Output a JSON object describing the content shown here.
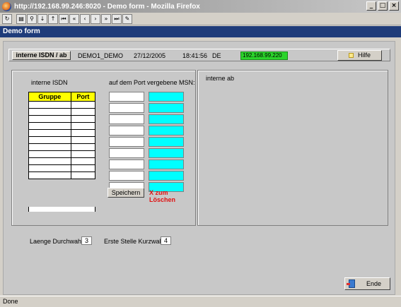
{
  "window": {
    "title": "http://192.168.99.246:8020 - Demo form - Mozilla Firefox"
  },
  "toolbar": {
    "icons": [
      "refresh-icon",
      "print-icon",
      "find-icon",
      "find-next-icon",
      "find-prev-icon",
      "first-record-icon",
      "previous-page-icon",
      "previous-icon",
      "next-icon",
      "next-page-icon",
      "last-record-icon",
      "edit-icon"
    ]
  },
  "page": {
    "title": "Demo form"
  },
  "infobar": {
    "module_label": "interne ISDN / ab",
    "user": "DEMO1_DEMO",
    "date": "27/12/2005",
    "time": "18:41:56",
    "lang": "DE",
    "ip": "192.168.99.220",
    "help_label": "Hilfe"
  },
  "left_panel": {
    "title": "interne ISDN",
    "msn_title": "auf dem Port vergebene MSN:",
    "table": {
      "headers": [
        "Gruppe",
        "Port"
      ],
      "row_count": 11
    },
    "msn_rows": 9,
    "save_label": "Speichern",
    "delete_label": "X zum Löschen"
  },
  "right_panel": {
    "title": "interne ab"
  },
  "settings": {
    "dial_length_label": "Laenge Durchwahl:",
    "dial_length_value": "3",
    "short_dial_label": "Erste Stelle Kurzwahl:",
    "short_dial_value": "4"
  },
  "footer": {
    "end_label": "Ende"
  },
  "status": {
    "text": "Done"
  },
  "colors": {
    "header_bg": "#1f3c7a",
    "ip_bg": "#2bd42b",
    "msn_cyan": "#00ffff",
    "table_header": "#ffff00",
    "delete_red": "#e01010"
  }
}
